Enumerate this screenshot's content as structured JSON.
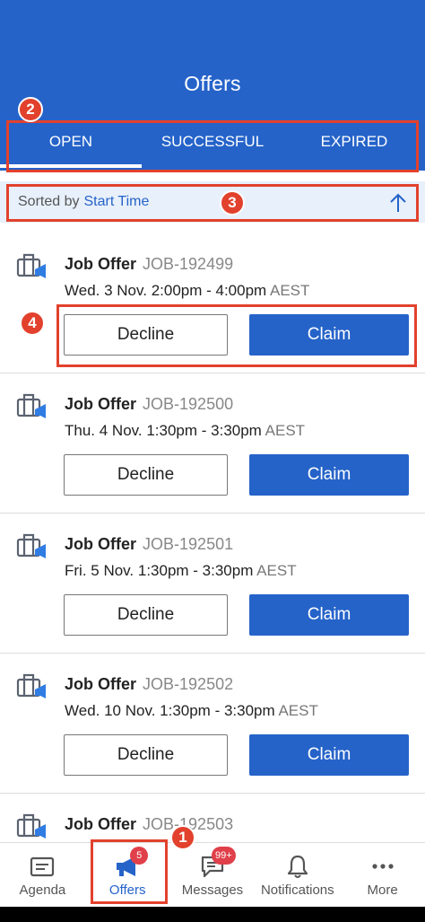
{
  "header": {
    "title": "Offers",
    "tabs": [
      {
        "label": "OPEN",
        "active": true
      },
      {
        "label": "SUCCESSFUL",
        "active": false
      },
      {
        "label": "EXPIRED",
        "active": false
      }
    ]
  },
  "sort": {
    "prefix": "Sorted by",
    "key": "Start Time",
    "direction": "ascending",
    "icon": "arrow-up-icon"
  },
  "offers": [
    {
      "label": "Job Offer",
      "id": "JOB-192499",
      "time": "Wed. 3 Nov. 2:00pm - 4:00pm",
      "tz": "AEST",
      "decline": "Decline",
      "claim": "Claim"
    },
    {
      "label": "Job Offer",
      "id": "JOB-192500",
      "time": "Thu. 4 Nov. 1:30pm - 3:30pm",
      "tz": "AEST",
      "decline": "Decline",
      "claim": "Claim"
    },
    {
      "label": "Job Offer",
      "id": "JOB-192501",
      "time": "Fri. 5 Nov. 1:30pm - 3:30pm",
      "tz": "AEST",
      "decline": "Decline",
      "claim": "Claim"
    },
    {
      "label": "Job Offer",
      "id": "JOB-192502",
      "time": "Wed. 10 Nov. 1:30pm - 3:30pm",
      "tz": "AEST",
      "decline": "Decline",
      "claim": "Claim"
    },
    {
      "label": "Job Offer",
      "id": "JOB-192503",
      "time": "",
      "tz": "",
      "decline": "",
      "claim": ""
    }
  ],
  "nav": [
    {
      "label": "Agenda",
      "icon": "agenda-icon",
      "active": false,
      "badge": ""
    },
    {
      "label": "Offers",
      "icon": "megaphone-icon",
      "active": true,
      "badge": "5"
    },
    {
      "label": "Messages",
      "icon": "chat-icon",
      "active": false,
      "badge": "99+"
    },
    {
      "label": "Notifications",
      "icon": "bell-icon",
      "active": false,
      "badge": ""
    },
    {
      "label": "More",
      "icon": "more-icon",
      "active": false,
      "badge": ""
    }
  ],
  "annotations": [
    "1",
    "2",
    "3",
    "4"
  ],
  "colors": {
    "primary": "#2563c9",
    "annotation": "#e2412d",
    "badge": "#e0404a",
    "sort_bar": "#e8f0fb"
  }
}
